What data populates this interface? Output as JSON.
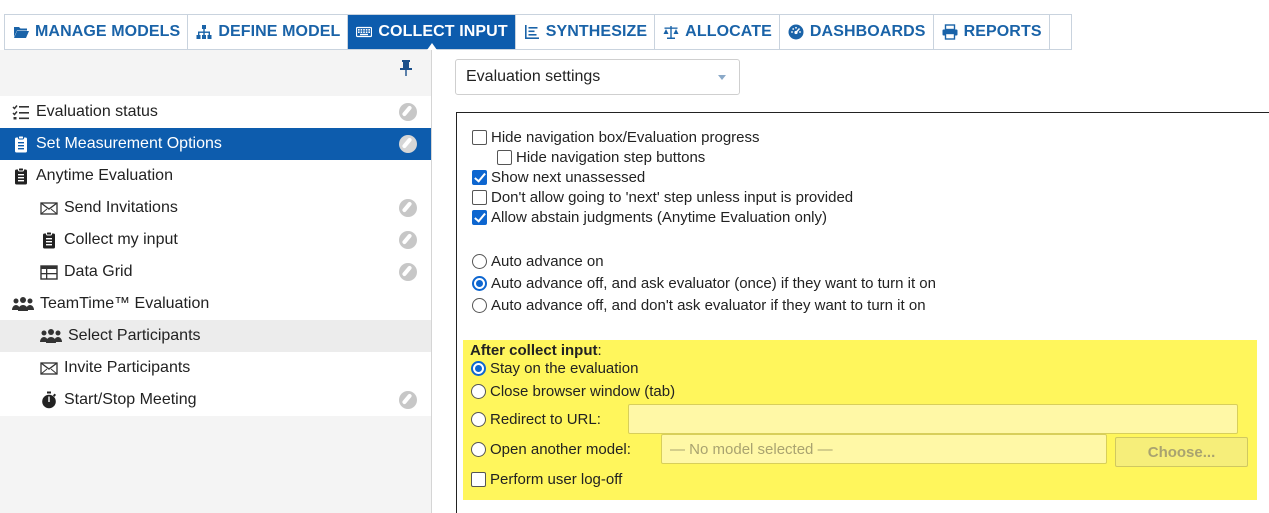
{
  "nav": {
    "tabs": [
      {
        "label": "MANAGE MODELS",
        "icon": "folder-open-icon"
      },
      {
        "label": "DEFINE MODEL",
        "icon": "hierarchy-icon"
      },
      {
        "label": "COLLECT INPUT",
        "icon": "keyboard-icon",
        "active": true
      },
      {
        "label": "SYNTHESIZE",
        "icon": "list-icon"
      },
      {
        "label": "ALLOCATE",
        "icon": "balance-scale-icon"
      },
      {
        "label": "DASHBOARDS",
        "icon": "dashboard-icon"
      },
      {
        "label": "REPORTS",
        "icon": "printer-icon"
      }
    ]
  },
  "sidebar": {
    "pin_icon": "pin-icon",
    "items": [
      {
        "label": "Evaluation status",
        "icon": "checklist-icon",
        "done": true
      },
      {
        "label": "Set Measurement Options",
        "icon": "clipboard-list-icon",
        "done": true,
        "selected": true
      },
      {
        "label": "Anytime Evaluation",
        "icon": "clipboard-icon",
        "done": false
      },
      {
        "label": "Send Invitations",
        "icon": "envelope-send-icon",
        "done": true
      },
      {
        "label": "Collect my input",
        "icon": "clipboard-icon",
        "done": true
      },
      {
        "label": "Data Grid",
        "icon": "table-grid-icon",
        "done": true
      },
      {
        "label": "TeamTime™ Evaluation",
        "icon": "users-icon",
        "done": false
      },
      {
        "label": "Select Participants",
        "icon": "users-icon",
        "done": false,
        "hover": true
      },
      {
        "label": "Invite Participants",
        "icon": "envelope-icon",
        "done": false
      },
      {
        "label": "Start/Stop Meeting",
        "icon": "stopwatch-icon",
        "done": true
      }
    ]
  },
  "main": {
    "settings_select": {
      "value": "Evaluation settings"
    },
    "options": {
      "hide_nav_box": {
        "label": "Hide navigation box/Evaluation progress",
        "checked": false
      },
      "hide_nav_buttons": {
        "label": "Hide navigation step buttons",
        "checked": false
      },
      "show_next_unassessed": {
        "label": "Show next unassessed",
        "checked": true
      },
      "dont_allow_next": {
        "label": "Don't allow going to 'next' step unless input is provided",
        "checked": false
      },
      "allow_abstain": {
        "label": "Allow abstain judgments (Anytime Evaluation only)",
        "checked": true
      }
    },
    "auto_advance": [
      {
        "label": "Auto advance on",
        "checked": false
      },
      {
        "label": "Auto advance off, and ask evaluator (once) if they want to turn it on",
        "checked": true
      },
      {
        "label": "Auto advance off, and don't ask evaluator if they want to turn it on",
        "checked": false
      }
    ],
    "after_collect": {
      "header": "After collect input",
      "header_colon": ":",
      "stay": {
        "label": "Stay on the evaluation",
        "checked": true
      },
      "close": {
        "label": "Close browser window (tab)",
        "checked": false
      },
      "redirect": {
        "label": "Redirect to URL:",
        "checked": false,
        "value": ""
      },
      "open_model": {
        "label": "Open another model:",
        "checked": false,
        "placeholder": "— No model selected —"
      },
      "choose_button": "Choose...",
      "logoff": {
        "label": "Perform user log-off",
        "checked": false
      }
    },
    "colors": {
      "accent": "#0d5cad",
      "highlight": "#fff65c",
      "check": "#0d66d0"
    }
  }
}
